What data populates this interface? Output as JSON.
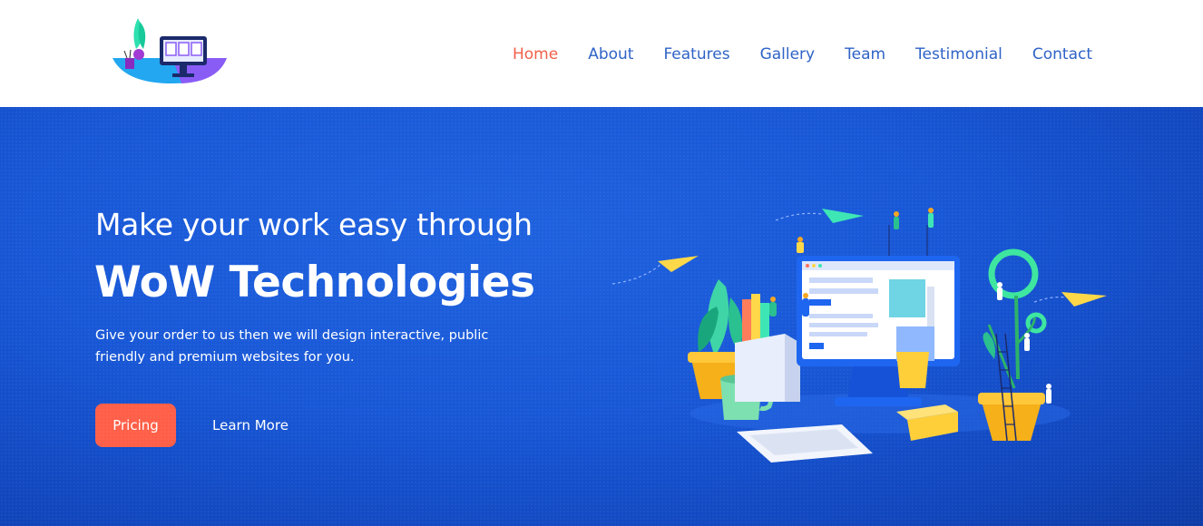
{
  "header": {
    "logo_icon": "desk-computer-plant-logo",
    "nav": [
      {
        "label": "Home",
        "active": true
      },
      {
        "label": "About",
        "active": false
      },
      {
        "label": "Features",
        "active": false
      },
      {
        "label": "Gallery",
        "active": false
      },
      {
        "label": "Team",
        "active": false
      },
      {
        "label": "Testimonial",
        "active": false
      },
      {
        "label": "Contact",
        "active": false
      }
    ]
  },
  "hero": {
    "tagline": "Make your work easy through",
    "brand": "WoW Technologies",
    "description": "Give your order to us then we will design interactive, public friendly and premium websites for you.",
    "pricing_label": "Pricing",
    "learn_more_label": "Learn More",
    "illustration_icon": "web-design-workspace-illustration"
  },
  "colors": {
    "nav_link": "#2f63c7",
    "nav_active": "#f0604a",
    "hero_bg": "#1857d6",
    "pricing_button": "#ff5f48"
  }
}
